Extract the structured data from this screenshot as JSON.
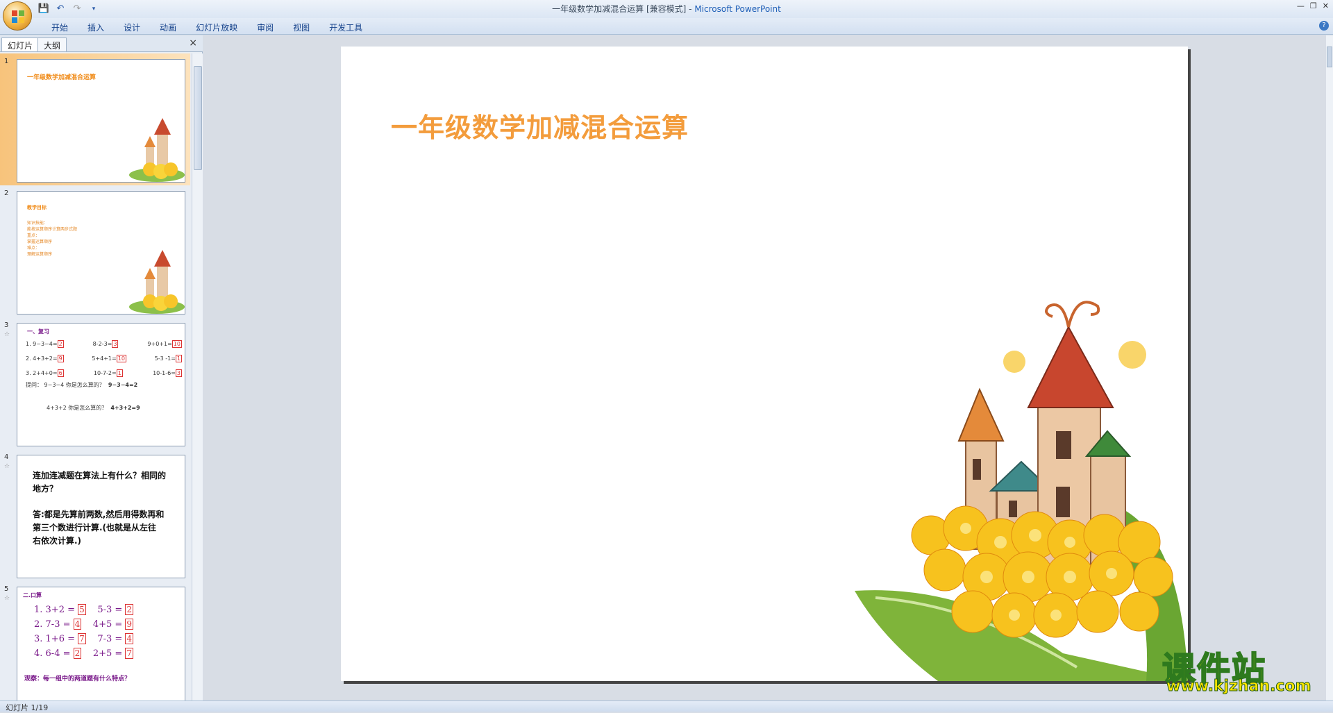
{
  "window": {
    "title_doc": "一年级数学加减混合运算 [兼容模式]",
    "title_sep": " - ",
    "title_app": "Microsoft PowerPoint"
  },
  "ribbon": {
    "tabs": [
      "开始",
      "插入",
      "设计",
      "动画",
      "幻灯片放映",
      "审阅",
      "视图",
      "开发工具"
    ]
  },
  "pane": {
    "tab_slides": "幻灯片",
    "tab_outline": "大纲",
    "close": "×"
  },
  "thumbnails": [
    {
      "num": "1",
      "title": "一年级数学加减混合运算"
    },
    {
      "num": "2",
      "title": "教学目标",
      "lines": [
        "知识技能：",
        "能按运算顺序计算两步式题",
        "重点：",
        "掌握运算顺序",
        "难点：",
        "理解运算顺序"
      ]
    },
    {
      "num": "3",
      "title": "一、复习",
      "rows": [
        [
          "1. 9−3−4=",
          "2",
          "8-2-3=",
          "3",
          "9+0+1=",
          "10"
        ],
        [
          "2. 4+3+2=",
          "9",
          "5+4+1=",
          "10",
          "5-3 -1=",
          "1"
        ],
        [
          "3. 2+4+0=",
          "6",
          "10-7-2=",
          "1",
          "10-1-6=",
          "3"
        ]
      ],
      "q1": "提问： 9−3−4  你是怎么算的？",
      "q1_expr": "9−3−4=2",
      "q2": "4+3+2  你是怎么算的？",
      "q2_expr": "4+3+2=9"
    },
    {
      "num": "4",
      "q": "连加连减题在算法上有什么？相同的地方？",
      "a": "答:都是先算前两数,然后用得数再和第三个数进行计算.(也就是从左往右依次计算.)"
    },
    {
      "num": "5",
      "title": "二.口算",
      "rows": [
        [
          "1. 3+2 =",
          "5",
          "5-3 =",
          "2"
        ],
        [
          "2. 7-3 =",
          "4",
          "4+5 =",
          "9"
        ],
        [
          "3. 1+6 =",
          "7",
          "7-3 =",
          "4"
        ],
        [
          "4. 6-4 =",
          "2",
          "2+5 =",
          "7"
        ]
      ],
      "footer": "观察：每一组中的两道题有什么特点？"
    }
  ],
  "slide": {
    "title": "一年级数学加减混合运算"
  },
  "status": {
    "slide_info": "幻灯片 1/19"
  },
  "watermark": {
    "cn": "课件站",
    "url": "www.kjzhan.com"
  }
}
